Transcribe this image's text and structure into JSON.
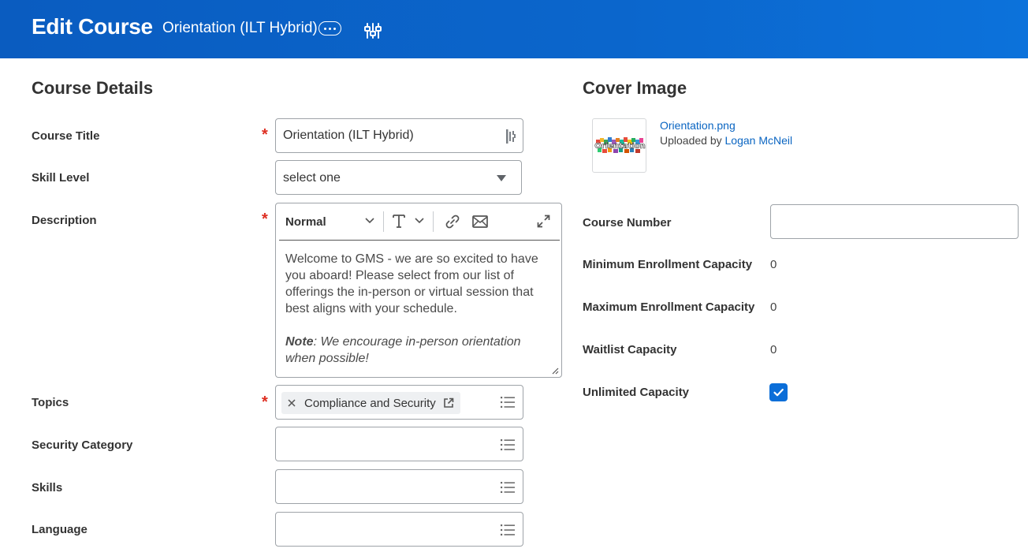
{
  "header": {
    "title": "Edit Course",
    "subtitle": "Orientation (ILT Hybrid)",
    "more_icon": "ellipsis-icon",
    "related_icon": "sliders-icon",
    "bg_color": "#0b66cc"
  },
  "course_details": {
    "title": "Course Details",
    "course_title": {
      "label": "Course Title",
      "value": "Orientation (ILT Hybrid)",
      "required": "*"
    },
    "skill_level": {
      "label": "Skill Level",
      "value": "select one"
    },
    "description": {
      "label": "Description",
      "required": "*",
      "format_option": "Normal",
      "text": "Welcome to GMS - we are so excited to have you aboard!  Please select from our list of offerings the in-person or virtual session that best aligns with your schedule.",
      "note_label": "Note",
      "note_text": ": We encourage in-person orientation when possible!"
    },
    "topics": {
      "label": "Topics",
      "required": "*",
      "chip": "Compliance and Security"
    },
    "security_category": {
      "label": "Security Category"
    },
    "skills": {
      "label": "Skills"
    },
    "language": {
      "label": "Language"
    }
  },
  "cover_image": {
    "title": "Cover Image",
    "file_name": "Orientation.png",
    "uploaded_by_prefix": "Uploaded by ",
    "uploaded_by_name": "Logan McNeil",
    "thumb_text": "Orientation"
  },
  "course_info": {
    "course_number_label": "Course Number",
    "min_enrollment_label": "Minimum Enrollment Capacity",
    "min_enrollment_value": "0",
    "max_enrollment_label": "Maximum Enrollment Capacity",
    "max_enrollment_value": "0",
    "waitlist_label": "Waitlist Capacity",
    "waitlist_value": "0",
    "unlimited_label": "Unlimited Capacity",
    "unlimited_checked": true
  },
  "colors": {
    "accent": "#0b6ed8",
    "required": "#de2e21",
    "link": "#0a65c2"
  }
}
